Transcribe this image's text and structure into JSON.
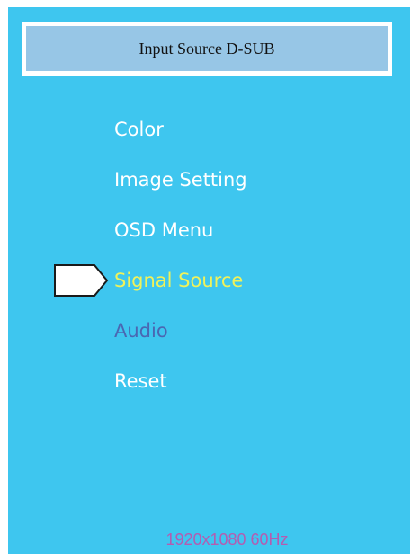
{
  "header": {
    "title": "Input Source D-SUB"
  },
  "menu": {
    "items": [
      {
        "label": "Color",
        "state": "normal"
      },
      {
        "label": "Image Setting",
        "state": "normal"
      },
      {
        "label": "OSD Menu",
        "state": "normal"
      },
      {
        "label": "Signal Source",
        "state": "selected"
      },
      {
        "label": "Audio",
        "state": "disabled"
      },
      {
        "label": "Reset",
        "state": "normal"
      }
    ],
    "pointer_icon": "pentagon-arrow-icon"
  },
  "status": {
    "resolution": "1920x1080 60Hz"
  },
  "colors": {
    "background": "#3ec6ef",
    "title_fill": "#97c6e6",
    "title_border": "#ffffff",
    "item_normal": "#ffffff",
    "item_selected": "#f0f25a",
    "item_disabled": "#4a67b2",
    "status_text": "#b35db1"
  }
}
